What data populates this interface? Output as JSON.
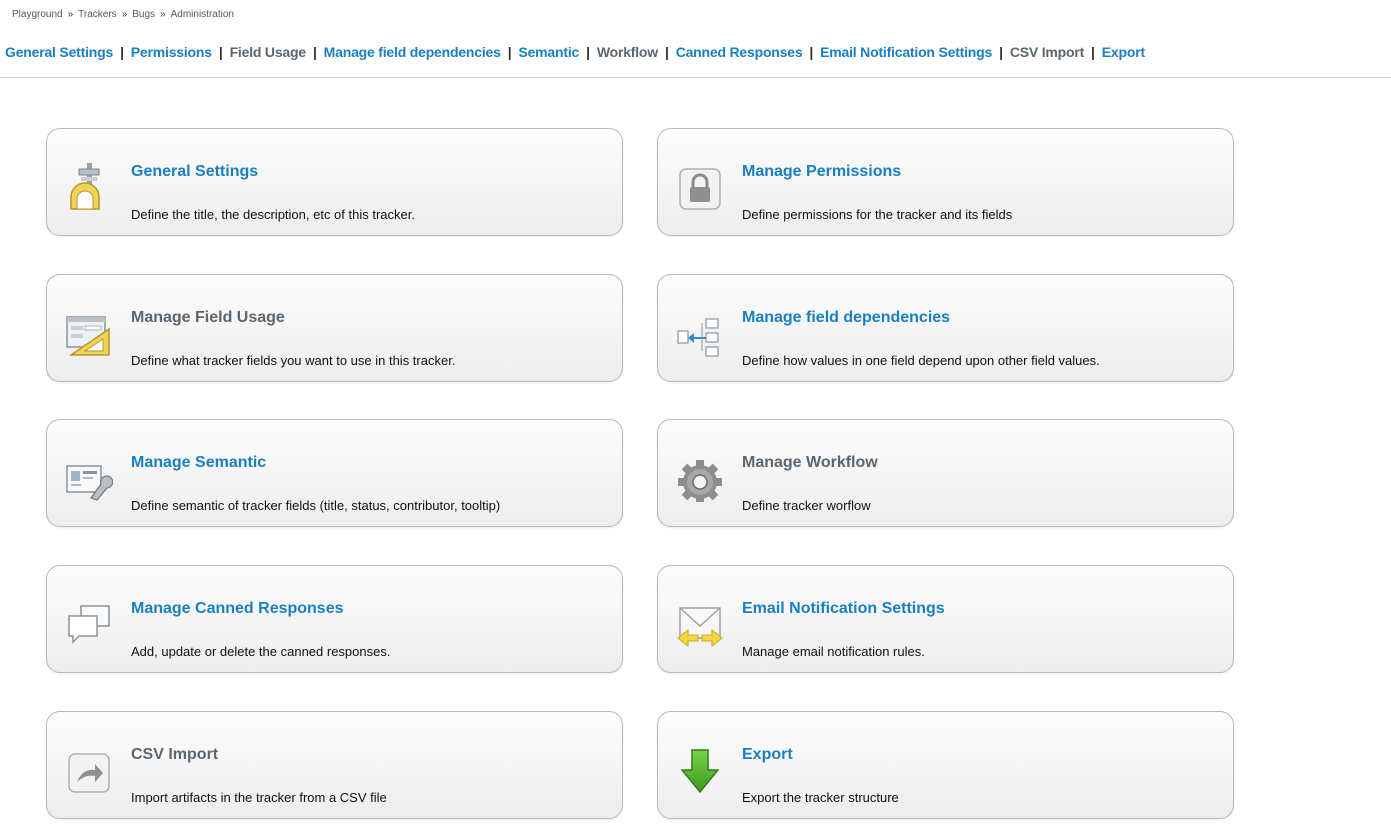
{
  "breadcrumb": [
    "Playground",
    "Trackers",
    "Bugs",
    "Administration"
  ],
  "breadcrumb_separator": "»",
  "nav": [
    {
      "label": "General Settings",
      "active": true
    },
    {
      "label": "Permissions",
      "active": true
    },
    {
      "label": "Field Usage",
      "active": false
    },
    {
      "label": "Manage field dependencies",
      "active": true
    },
    {
      "label": "Semantic",
      "active": true
    },
    {
      "label": "Workflow",
      "active": false
    },
    {
      "label": "Canned Responses",
      "active": true
    },
    {
      "label": "Email Notification Settings",
      "active": true
    },
    {
      "label": "CSV Import",
      "active": false
    },
    {
      "label": "Export",
      "active": true
    }
  ],
  "nav_separator": "|",
  "cards": [
    {
      "title": "General Settings",
      "desc": "Define the title, the description, etc of this tracker.",
      "icon": "calipers-ruler-icon"
    },
    {
      "title": "Manage Permissions",
      "desc": "Define permissions for the tracker and its fields",
      "icon": "lock-icon"
    },
    {
      "title": "Manage Field Usage",
      "desc": "Define what tracker fields you want to use in this tracker.",
      "icon": "form-ruler-icon"
    },
    {
      "title": "Manage field dependencies",
      "desc": "Define how values in one field depend upon other field values.",
      "icon": "dependencies-icon"
    },
    {
      "title": "Manage Semantic",
      "desc": "Define semantic of tracker fields (title, status, contributor, tooltip)",
      "icon": "id-card-wrench-icon"
    },
    {
      "title": "Manage Workflow",
      "desc": "Define tracker worflow",
      "icon": "gear-icon"
    },
    {
      "title": "Manage Canned Responses",
      "desc": "Add, update or delete the canned responses.",
      "icon": "speech-bubbles-icon"
    },
    {
      "title": "Email Notification Settings",
      "desc": "Manage email notification rules.",
      "icon": "envelope-arrows-icon"
    },
    {
      "title": "CSV Import",
      "desc": "Import artifacts in the tracker from a CSV file",
      "icon": "import-arrow-icon"
    },
    {
      "title": "Export",
      "desc": "Export the tracker structure",
      "icon": "green-down-arrow-icon"
    }
  ],
  "colors": {
    "link": "#1a7fc1",
    "muted": "#5a6670"
  }
}
